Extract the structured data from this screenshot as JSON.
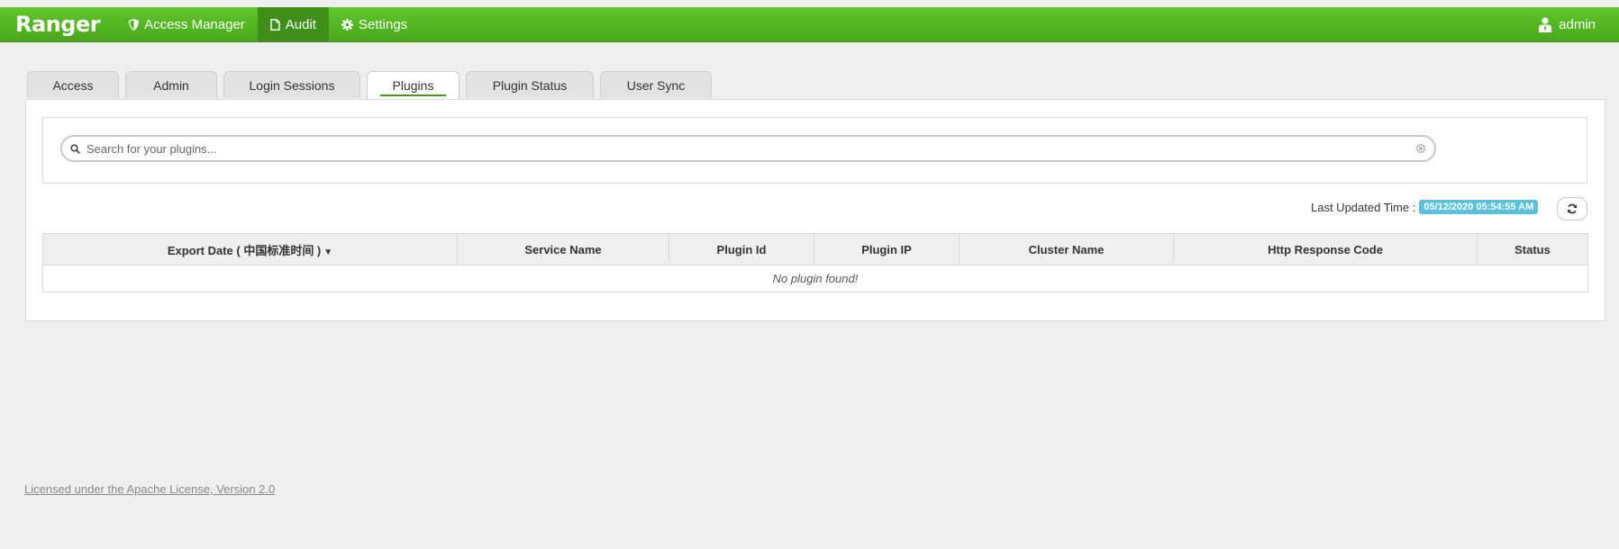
{
  "navbar": {
    "brand": "Ranger",
    "items": [
      {
        "label": "Access Manager",
        "icon": "shield-icon",
        "active": false
      },
      {
        "label": "Audit",
        "icon": "file-icon",
        "active": true
      },
      {
        "label": "Settings",
        "icon": "gear-icon",
        "active": false
      }
    ],
    "user": "admin",
    "color": "#52b421"
  },
  "tabs": [
    {
      "label": "Access"
    },
    {
      "label": "Admin"
    },
    {
      "label": "Login Sessions"
    },
    {
      "label": "Plugins",
      "active": true
    },
    {
      "label": "Plugin Status"
    },
    {
      "label": "User Sync"
    }
  ],
  "search": {
    "placeholder": "Search for your plugins...",
    "value": ""
  },
  "last_updated": {
    "label": "Last Updated Time :",
    "value": "05/12/2020 05:54:55 AM"
  },
  "table": {
    "columns": [
      "Export Date ( 中国标准时间 )",
      "Service Name",
      "Plugin Id",
      "Plugin IP",
      "Cluster Name",
      "Http Response Code",
      "Status"
    ],
    "empty_message": "No plugin found!"
  },
  "footer": {
    "license": "Licensed under the Apache License, Version 2.0"
  }
}
